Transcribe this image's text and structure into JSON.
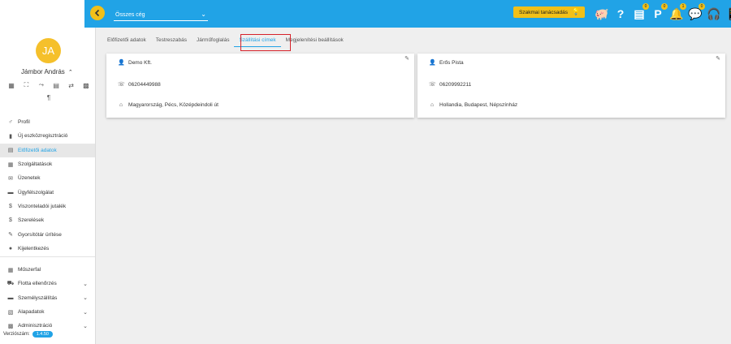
{
  "header": {
    "company_select": "Összes cég",
    "advisor_button": "Szakmai tanácsadás",
    "icons": [
      {
        "name": "piggy-bank-icon",
        "glyph": "🐖",
        "badge": ""
      },
      {
        "name": "help-icon",
        "glyph": "?",
        "badge": ""
      },
      {
        "name": "document-icon",
        "glyph": "▤",
        "badge": "0"
      },
      {
        "name": "parking-icon",
        "glyph": "P",
        "badge": "0"
      },
      {
        "name": "bell-icon",
        "glyph": "🔔",
        "badge": "1"
      },
      {
        "name": "chat-icon",
        "glyph": "💬",
        "badge": "0"
      },
      {
        "name": "headset-icon",
        "glyph": "🎧",
        "badge": ""
      },
      {
        "name": "phone-download-icon",
        "glyph": "📱",
        "badge": ""
      }
    ]
  },
  "user": {
    "initials": "JA",
    "name": "Jámbor András"
  },
  "sidebar": {
    "items": [
      {
        "label": "Profil",
        "icon": "♂"
      },
      {
        "label": "Új eszközregisztráció",
        "icon": "▮"
      },
      {
        "label": "Előfizetői adatok",
        "icon": "▤",
        "active": true
      },
      {
        "label": "Szolgáltatások",
        "icon": "▦"
      },
      {
        "label": "Üzenetek",
        "icon": "✉"
      },
      {
        "label": "Ügyfélszolgálat",
        "icon": "▬"
      },
      {
        "label": "Viszonteladói jutalék",
        "icon": "$"
      },
      {
        "label": "Szerelések",
        "icon": "$"
      },
      {
        "label": "Gyorsítótár ürítése",
        "icon": "✎"
      },
      {
        "label": "Kijelentkezés",
        "icon": "●"
      }
    ],
    "items2": [
      {
        "label": "Műszerfal",
        "icon": "▦",
        "expand": false
      },
      {
        "label": "Flotta ellenőrzés",
        "icon": "⛟",
        "expand": true
      },
      {
        "label": "Személyszállítás",
        "icon": "▬",
        "expand": true
      },
      {
        "label": "Alapadatok",
        "icon": "▧",
        "expand": true
      },
      {
        "label": "Adminisztráció",
        "icon": "▩",
        "expand": true
      }
    ],
    "version_label": "Verziószám:",
    "version": "1.4.50"
  },
  "tabs": [
    {
      "label": "Előfizetői adatok",
      "active": false
    },
    {
      "label": "Testreszabás",
      "active": false
    },
    {
      "label": "Járműfoglalás",
      "active": false
    },
    {
      "label": "Szállítási címek",
      "active": true
    },
    {
      "label": "Megjelenítési beállítások",
      "active": false
    }
  ],
  "addresses": [
    {
      "name": "Demo Kft.",
      "phone": "06204449988",
      "address": "Magyarország, Pécs, Középdeindoli út"
    },
    {
      "name": "Erős Pista",
      "phone": "06209992211",
      "address": "Hollandia, Budapest, Népszínház"
    }
  ],
  "colors": {
    "primary": "#21a3e6",
    "accent": "#f2c018",
    "highlight": "#d6222a"
  }
}
